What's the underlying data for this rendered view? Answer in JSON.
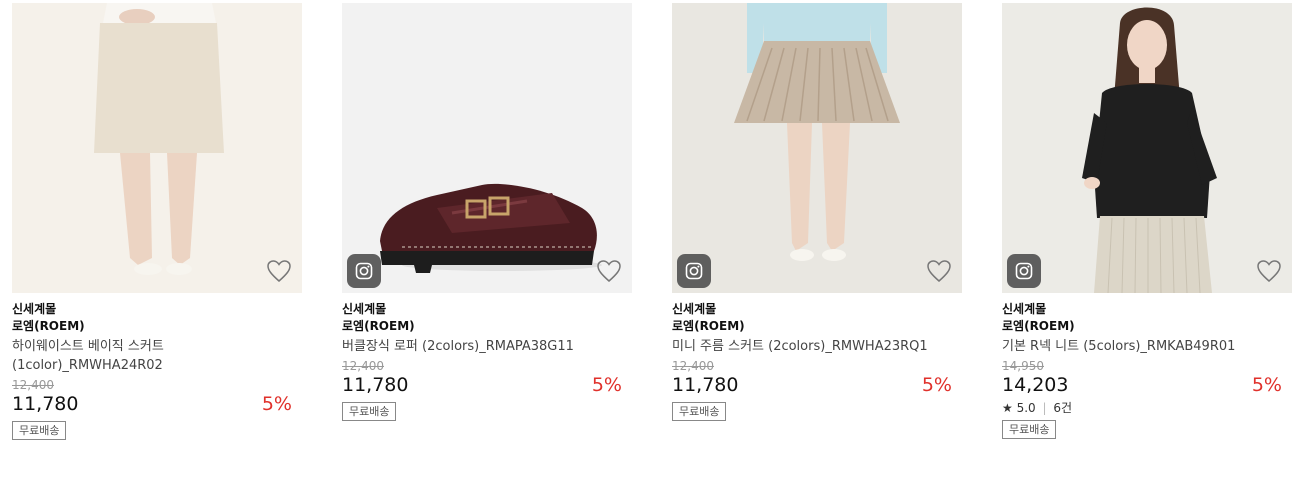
{
  "products": [
    {
      "seller": "신세계몰",
      "brand": "로엠(ROEM)",
      "name_line1": "하이웨이스트 베이직 스커트",
      "name_line2": "(1color)_RMWHA24R02",
      "original_price": "12,400",
      "price": "11,780",
      "discount": "5%",
      "badge": "무료배송"
    },
    {
      "seller": "신세계몰",
      "brand": "로엠(ROEM)",
      "name_line1": "버클장식 로퍼 (2colors)_RMAPA38G11",
      "original_price": "12,400",
      "price": "11,780",
      "discount": "5%",
      "badge": "무료배송"
    },
    {
      "seller": "신세계몰",
      "brand": "로엠(ROEM)",
      "name_line1": "미니 주름 스커트 (2colors)_RMWHA23RQ1",
      "original_price": "12,400",
      "price": "11,780",
      "discount": "5%",
      "badge": "무료배송"
    },
    {
      "seller": "신세계몰",
      "brand": "로엠(ROEM)",
      "name_line1": "기본 R넥 니트 (5colors)_RMKAB49R01",
      "original_price": "14,950",
      "price": "14,203",
      "discount": "5%",
      "rating_star": "★",
      "rating": "5.0",
      "review_count": "6건",
      "badge": "무료배송"
    }
  ],
  "colors": {
    "discount": "#e0312b",
    "badge_border": "#888888"
  },
  "icons": [
    "heart-outline-icon",
    "instagram-icon"
  ]
}
